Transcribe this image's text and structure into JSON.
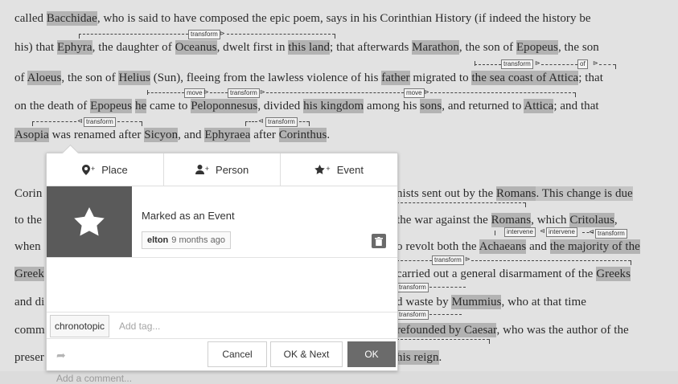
{
  "text_lines": [
    {
      "segments": [
        {
          "t": "called ",
          "h": 0
        },
        {
          "t": "Bacchidae",
          "h": 1
        },
        {
          "t": ", who is said to have composed the epic poem, says in his Corinthian History (if indeed the history be",
          "h": 0
        }
      ]
    },
    {
      "segments": [
        {
          "t": "his) that ",
          "h": 0
        },
        {
          "t": "Ephyra",
          "h": 1
        },
        {
          "t": ", the daughter of ",
          "h": 0
        },
        {
          "t": "Oceanus",
          "h": 1
        },
        {
          "t": ", dwelt first in ",
          "h": 0
        },
        {
          "t": "this land",
          "h": 1
        },
        {
          "t": "; that afterwards ",
          "h": 0
        },
        {
          "t": "Marathon",
          "h": 1
        },
        {
          "t": ", the son of ",
          "h": 0
        },
        {
          "t": "Epopeus",
          "h": 1
        },
        {
          "t": ", the son",
          "h": 0
        }
      ]
    },
    {
      "segments": [
        {
          "t": "of ",
          "h": 0
        },
        {
          "t": "Aloeus",
          "h": 1
        },
        {
          "t": ", the son of ",
          "h": 0
        },
        {
          "t": "Helius",
          "h": 1
        },
        {
          "t": " (Sun), fleeing from the lawless violence of his ",
          "h": 0
        },
        {
          "t": "father",
          "h": 1
        },
        {
          "t": " migrated to ",
          "h": 0
        },
        {
          "t": "the sea coast of Attica",
          "h": 1
        },
        {
          "t": "; that",
          "h": 0
        }
      ]
    },
    {
      "segments": [
        {
          "t": "on the death of ",
          "h": 0
        },
        {
          "t": "Epopeus",
          "h": 1
        },
        {
          "t": " ",
          "h": 0
        },
        {
          "t": "he",
          "h": 1
        },
        {
          "t": " came to ",
          "h": 0
        },
        {
          "t": "Peloponnesus",
          "h": 1
        },
        {
          "t": ", divided ",
          "h": 0
        },
        {
          "t": "his kingdom",
          "h": 1
        },
        {
          "t": " among his ",
          "h": 0
        },
        {
          "t": "sons",
          "h": 1
        },
        {
          "t": ", and returned to ",
          "h": 0
        },
        {
          "t": "Attica",
          "h": 1
        },
        {
          "t": "; and that",
          "h": 0
        }
      ]
    },
    {
      "segments": [
        {
          "t": "Asopia",
          "h": 1
        },
        {
          "t": " was renamed after ",
          "h": 0
        },
        {
          "t": "Sicyon",
          "h": 1
        },
        {
          "t": ", and ",
          "h": 0
        },
        {
          "t": "Ephyraea",
          "h": 1
        },
        {
          "t": " after ",
          "h": 0
        },
        {
          "t": "Corinthus",
          "h": 1
        },
        {
          "t": ".",
          "h": 0
        }
      ]
    }
  ],
  "left_fragments": [
    "Corin",
    "to the",
    "when",
    "Greek",
    "and di",
    "comm",
    "preser"
  ],
  "right_lines": [
    {
      "segments": [
        {
          "t": "nists sent out by the ",
          "h": 0
        },
        {
          "t": "Romans",
          "h": 1
        },
        {
          "t": ". This change is due",
          "h": 2
        }
      ]
    },
    {
      "segments": [
        {
          "t": " the war against the ",
          "h": 0
        },
        {
          "t": "Romans",
          "h": 1
        },
        {
          "t": ", which ",
          "h": 0
        },
        {
          "t": "Critolaus",
          "h": 1
        },
        {
          "t": ",",
          "h": 0
        }
      ]
    },
    {
      "segments": [
        {
          "t": "o revolt both the ",
          "h": 0
        },
        {
          "t": "Achaeans",
          "h": 1
        },
        {
          "t": " and ",
          "h": 0
        },
        {
          "t": "the majority of the",
          "h": 1
        }
      ]
    },
    {
      "segments": [
        {
          "t": "carried out a general disarmament of the ",
          "h": 0
        },
        {
          "t": "Greeks",
          "h": 1
        }
      ]
    },
    {
      "segments": [
        {
          "t": "d waste by ",
          "h": 0
        },
        {
          "t": "Mummius",
          "h": 1
        },
        {
          "t": ", who at that time",
          "h": 0
        }
      ]
    },
    {
      "segments": [
        {
          "t": " refounded by ",
          "h": 1
        },
        {
          "t": "Caesar",
          "h": 1
        },
        {
          "t": ", who was the author of the",
          "h": 0
        }
      ]
    },
    {
      "segments": [
        {
          "t": "his reign",
          "h": 1
        },
        {
          "t": ".",
          "h": 0
        }
      ]
    }
  ],
  "relations": {
    "transform": "transform",
    "move": "move",
    "of": "of",
    "intervene": "intervene"
  },
  "popup": {
    "tabs": [
      {
        "label": "Place",
        "icon": "map-marker-plus-icon",
        "glyph": "⚲"
      },
      {
        "label": "Person",
        "icon": "person-plus-icon",
        "glyph": "♟"
      },
      {
        "label": "Event",
        "icon": "star-plus-icon",
        "glyph": "★"
      }
    ],
    "annotation_text": "Marked as an Event",
    "user": "elton",
    "time_ago": "9 months ago",
    "comment_placeholder": "Add a comment...",
    "tag": "chronotopic",
    "tag_placeholder": "Add tag...",
    "buttons": {
      "cancel": "Cancel",
      "ok_next": "OK & Next",
      "ok": "OK"
    }
  },
  "colors": {
    "highlight": "#b3b3b3",
    "event_box": "#5a5a5a",
    "ok_button": "#6b6b6b"
  }
}
